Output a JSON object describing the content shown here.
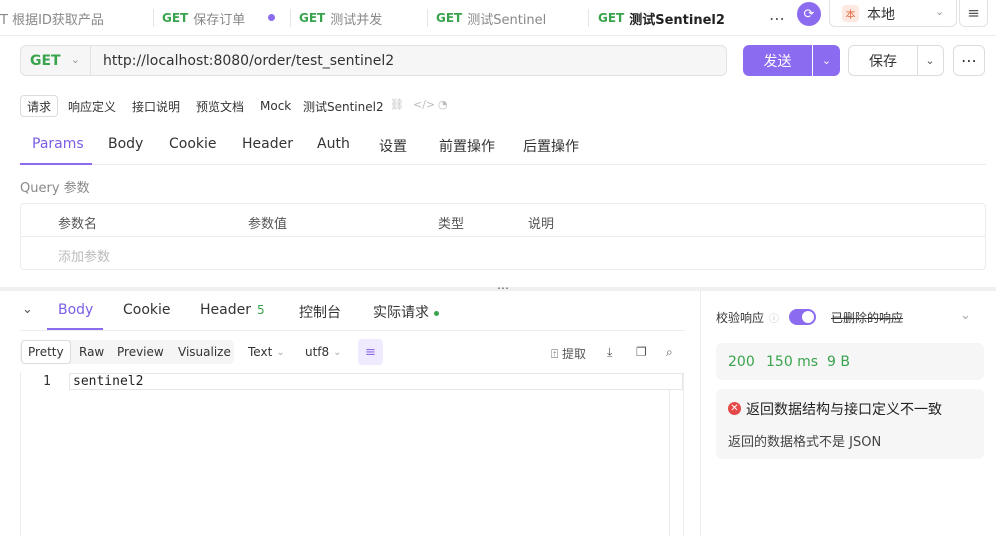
{
  "tabs": [
    {
      "method": "",
      "label": "T 根据ID获取产品"
    },
    {
      "method": "GET",
      "label": "保存订单"
    },
    {
      "method": "GET",
      "label": "测试并发"
    },
    {
      "method": "GET",
      "label": "测试Sentinel"
    },
    {
      "method": "GET",
      "label": "测试Sentinel2"
    }
  ],
  "env": {
    "badge": "本",
    "label": "本地"
  },
  "request": {
    "method": "GET",
    "url": "http://localhost:8080/order/test_sentinel2",
    "send_label": "发送",
    "save_label": "保存"
  },
  "subtabs": [
    "请求",
    "响应定义",
    "接口说明",
    "预览文档",
    "Mock",
    "测试Sentinel2"
  ],
  "param_tabs": [
    "Params",
    "Body",
    "Cookie",
    "Header",
    "Auth",
    "设置",
    "前置操作",
    "后置操作"
  ],
  "query": {
    "title": "Query 参数",
    "headers": [
      "参数名",
      "参数值",
      "类型",
      "说明"
    ],
    "add_placeholder": "添加参数"
  },
  "response": {
    "tabs": [
      "Body",
      "Cookie",
      "Header",
      "控制台",
      "实际请求"
    ],
    "header_count": "5",
    "views": [
      "Pretty",
      "Raw",
      "Preview",
      "Visualize"
    ],
    "format": "Text",
    "encoding": "utf8",
    "extract_label": "提取",
    "line_number": "1",
    "body_text": "sentinel2"
  },
  "validation": {
    "label": "校验响应",
    "deleted_label": "已删除的响应",
    "status": "200",
    "time": "150 ms",
    "size": "9 B",
    "error_title": "返回数据结构与接口定义不一致",
    "error_desc": "返回的数据格式不是 JSON"
  },
  "colors": {
    "accent": "#8b6cf0",
    "method": "#3aa34d",
    "error": "#e54848"
  }
}
